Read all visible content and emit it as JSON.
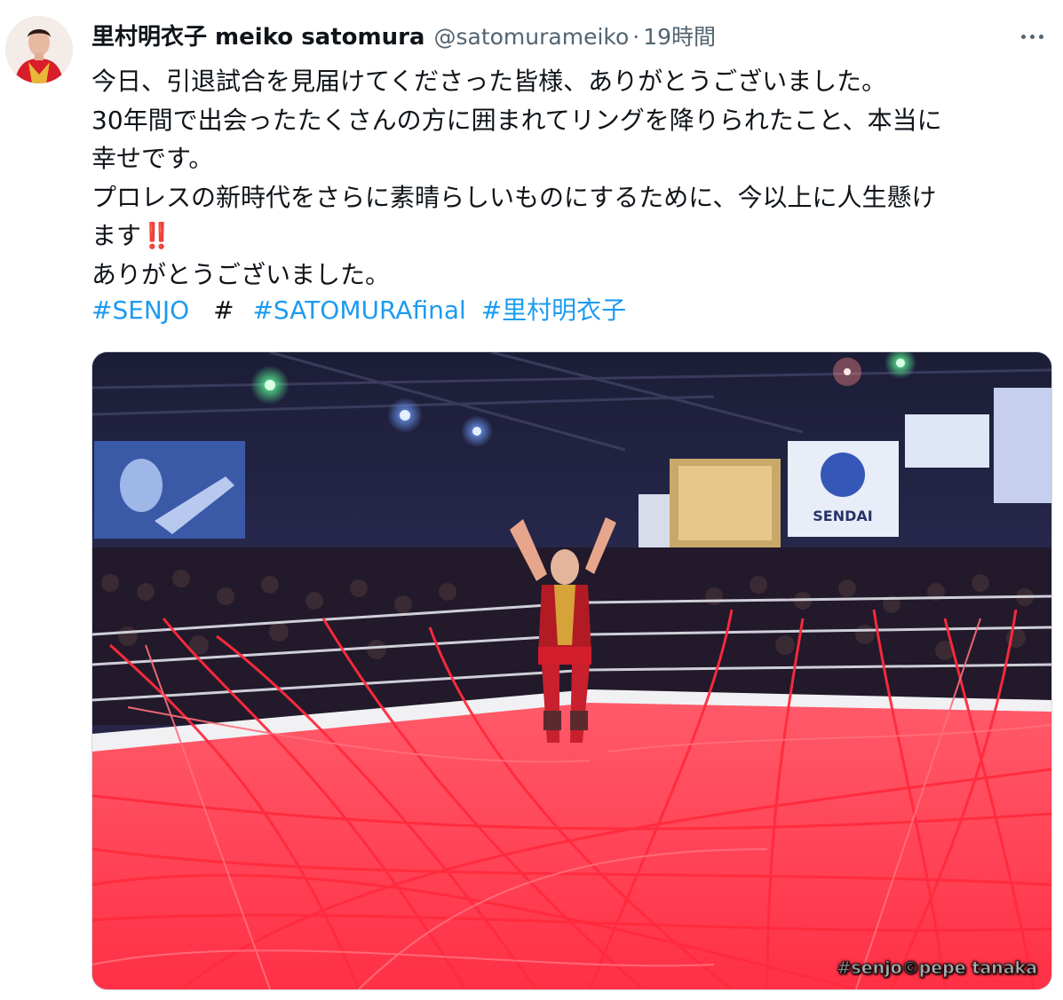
{
  "tweet": {
    "display_name": "里村明衣子 meiko satomura",
    "handle": "@satomurameiko",
    "separator": "·",
    "time": "19時間",
    "lines": [
      "今日、引退試合を見届けてくださった皆様、ありがとうございました。",
      "30年間で出会ったたくさんの方に囲まれてリングを降りられたこと、本当に",
      "幸せです。",
      "プロレスの新時代をさらに素晴らしいものにするために、今以上に人生懸け",
      "ます",
      "ありがとうございました。"
    ],
    "emphasis": "‼️",
    "hashtags": [
      "#SENJO",
      "#",
      "#SATOMURAfinal",
      "#里村明衣子"
    ],
    "photo_credit": "#senjo©pepe tanaka",
    "banner_text": "SENDAI"
  },
  "icons": {
    "more": "more-horizontal-icon",
    "avatar": "profile-avatar"
  },
  "colors": {
    "link": "#1d9bf0",
    "secondary_text": "#536471",
    "streamer_red": "#ff2b3d"
  }
}
